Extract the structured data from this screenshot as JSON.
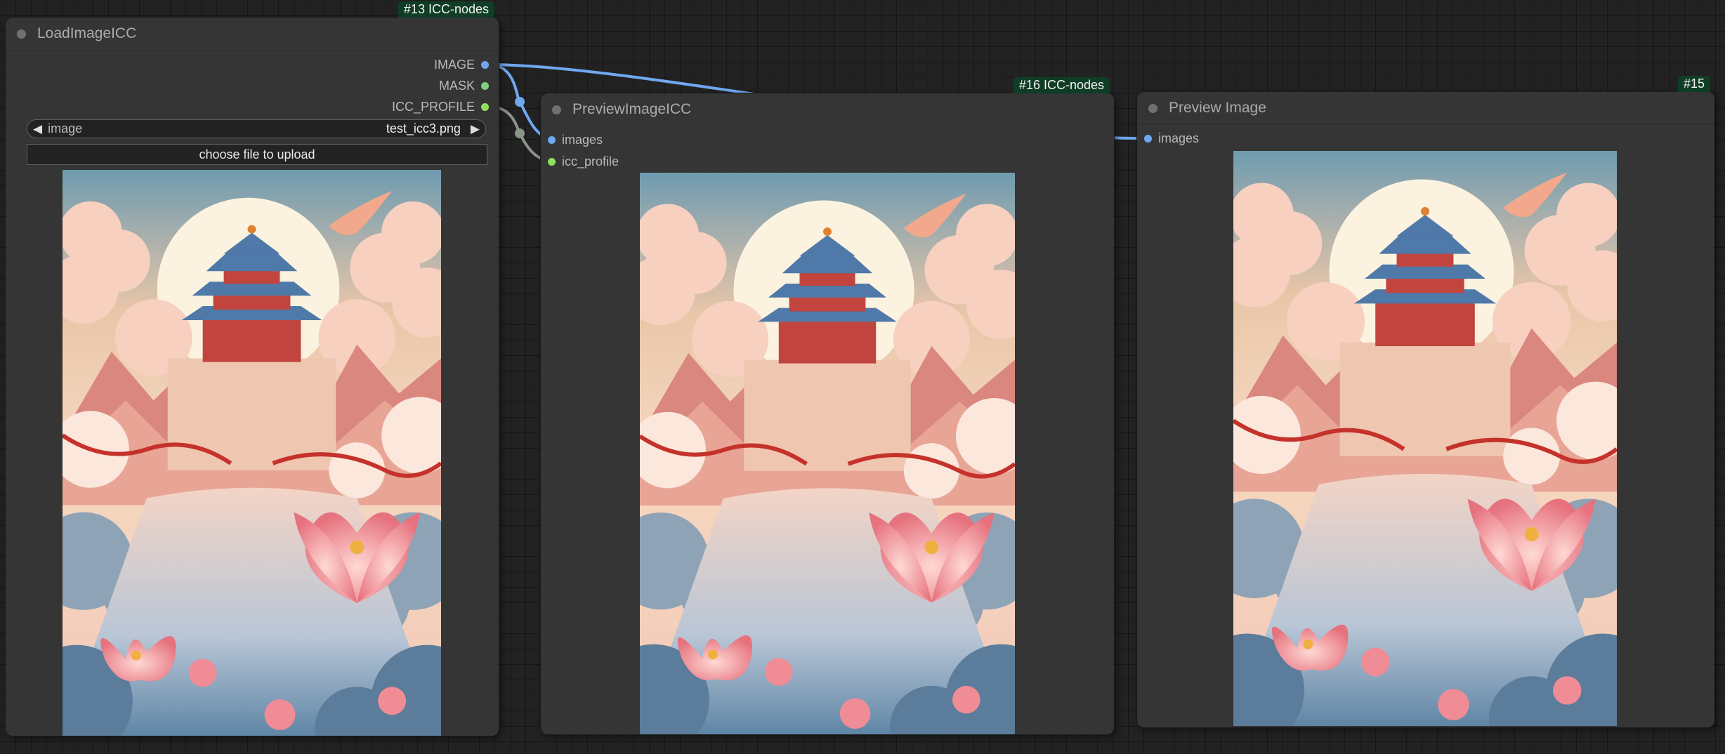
{
  "nodes": {
    "load": {
      "badge": "#13 ICC-nodes",
      "title": "LoadImageICC",
      "outputs": [
        "IMAGE",
        "MASK",
        "ICC_PROFILE"
      ],
      "image_widget": {
        "label": "image",
        "value": "test_icc3.png"
      },
      "upload_button": "choose file to upload"
    },
    "preview_icc": {
      "badge": "#16 ICC-nodes",
      "title": "PreviewImageICC",
      "inputs": [
        "images",
        "icc_profile"
      ]
    },
    "preview": {
      "badge": "#15",
      "title": "Preview Image",
      "inputs": [
        "images"
      ]
    }
  },
  "colors": {
    "image_slot": "#6fa8f0",
    "mask_slot": "#7fd17f",
    "icc_slot": "#90e060",
    "image_link": "#6fa8f0",
    "icc_link": "#8a9488",
    "badge": "#0f3d25"
  }
}
